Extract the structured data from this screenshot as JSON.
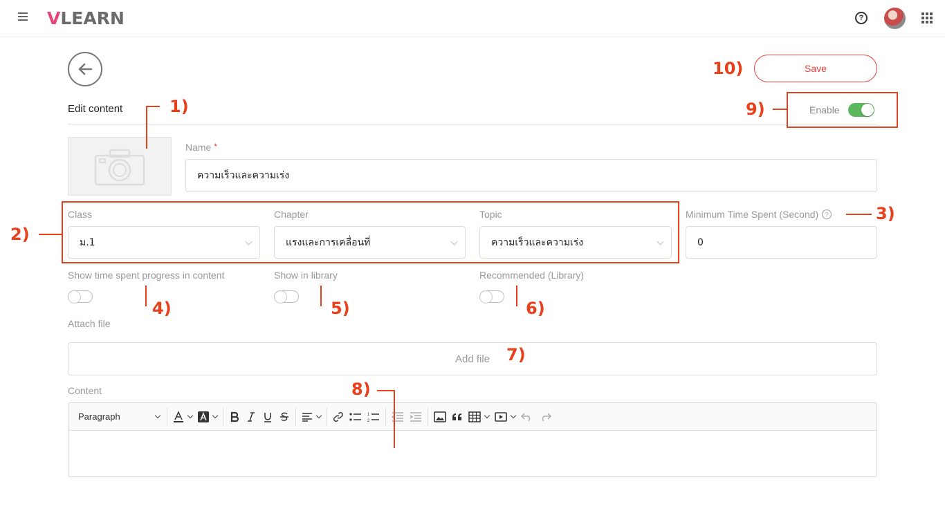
{
  "header": {
    "logo_v": "V",
    "logo_rest": "LEARN",
    "help_glyph": "?"
  },
  "page": {
    "title": "Edit content",
    "save_label": "Save",
    "enable_label": "Enable",
    "enable_on": true
  },
  "form": {
    "name_label": "Name",
    "required_mark": "*",
    "name_value": "ความเร็วและความเร่ง",
    "class_label": "Class",
    "class_value": "ม.1",
    "chapter_label": "Chapter",
    "chapter_value": "แรงและการเคลื่อนที่",
    "topic_label": "Topic",
    "topic_value": "ความเร็วและความเร่ง",
    "min_time_label": "Minimum Time Spent (Second)",
    "min_time_value": "0",
    "show_progress_label": "Show time spent progress in content",
    "show_library_label": "Show in library",
    "recommended_label": "Recommended (Library)",
    "attach_label": "Attach file",
    "add_file_label": "Add file",
    "content_label": "Content"
  },
  "editor": {
    "paragraph_label": "Paragraph"
  },
  "annotations": [
    "1)",
    "2)",
    "3)",
    "4)",
    "5)",
    "6)",
    "7)",
    "8)",
    "9)",
    "10)"
  ],
  "colors": {
    "accent": "#e5403a",
    "annotation": "#e8401c",
    "toggle_on": "#5cb85c"
  },
  "icons": [
    "menu-icon",
    "help-icon",
    "avatar",
    "apps-grid-icon",
    "back-arrow-icon",
    "camera-icon",
    "help-circle-icon",
    "chevron-down-icon"
  ]
}
